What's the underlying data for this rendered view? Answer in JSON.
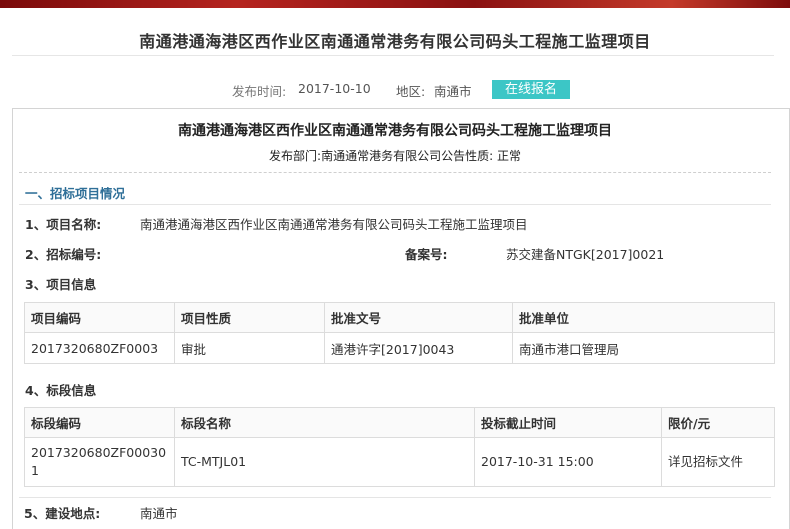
{
  "page": {
    "title": "南通港通海港区西作业区南通通常港务有限公司码头工程施工监理项目",
    "publish_time_label": "发布时间:",
    "publish_time": "2017-10-10",
    "region_label": "地区:",
    "region": "南通市",
    "online_signup": "在线报名"
  },
  "doc": {
    "title": "南通港通海港区西作业区南通通常港务有限公司码头工程施工监理项目",
    "dept_label": "发布部门:",
    "dept": "南通通常港务有限公司",
    "nature_label": "公告性质:",
    "nature": "正常",
    "section_title": "一、招标项目情况"
  },
  "fields": {
    "project_name_label": "1、项目名称:",
    "project_name": "南通港通海港区西作业区南通通常港务有限公司码头工程施工监理项目",
    "bid_no_label": "2、招标编号:",
    "bid_no": "",
    "record_no_label": "备案号:",
    "record_no": "苏交建备NTGK[2017]0021",
    "project_info_label": "3、项目信息",
    "section_info_label": "4、标段信息",
    "construction_site_label": "5、建设地点:",
    "construction_site": "南通市"
  },
  "project_table": {
    "headers": [
      "项目编码",
      "项目性质",
      "批准文号",
      "批准单位"
    ],
    "rows": [
      [
        "2017320680ZF0003",
        "审批",
        "通港许字[2017]0043",
        "南通市港口管理局"
      ]
    ]
  },
  "section_table": {
    "headers": [
      "标段编码",
      "标段名称",
      "投标截止时间",
      "限价/元"
    ],
    "rows": [
      [
        "2017320680ZF000301",
        "TC-MTJL01",
        "2017-10-31 15:00",
        "详见招标文件"
      ]
    ]
  },
  "colors": {
    "accent": "#3cc6c6",
    "section_blue": "#2f6f98",
    "banner_red": "#b5241f"
  }
}
